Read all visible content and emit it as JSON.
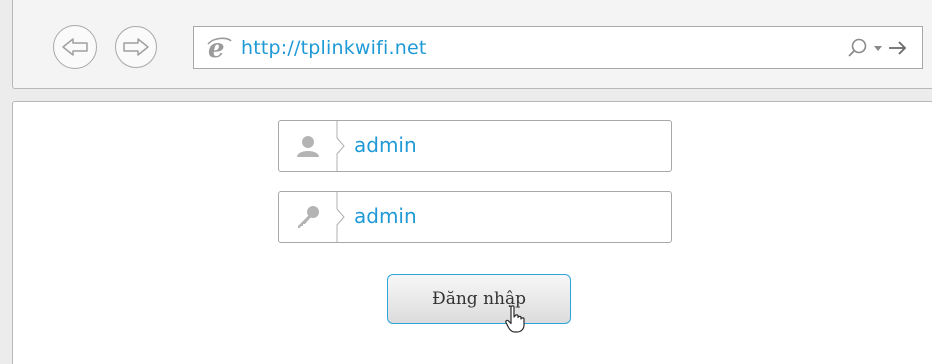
{
  "browser": {
    "url": "http://tplinkwifi.net"
  },
  "login": {
    "username_value": "admin",
    "password_value": "admin",
    "submit_label": "Đăng nhập"
  },
  "icons": {
    "back": "back-arrow-icon",
    "forward": "forward-arrow-icon",
    "browser": "internet-explorer-icon",
    "search": "search-icon",
    "dropdown": "dropdown-icon",
    "go": "go-arrow-icon",
    "user": "user-icon",
    "password": "key-icon",
    "cursor": "hand-cursor-icon"
  },
  "colors": {
    "accent_text": "#1f9ad6",
    "button_border": "#2fa6d9"
  }
}
